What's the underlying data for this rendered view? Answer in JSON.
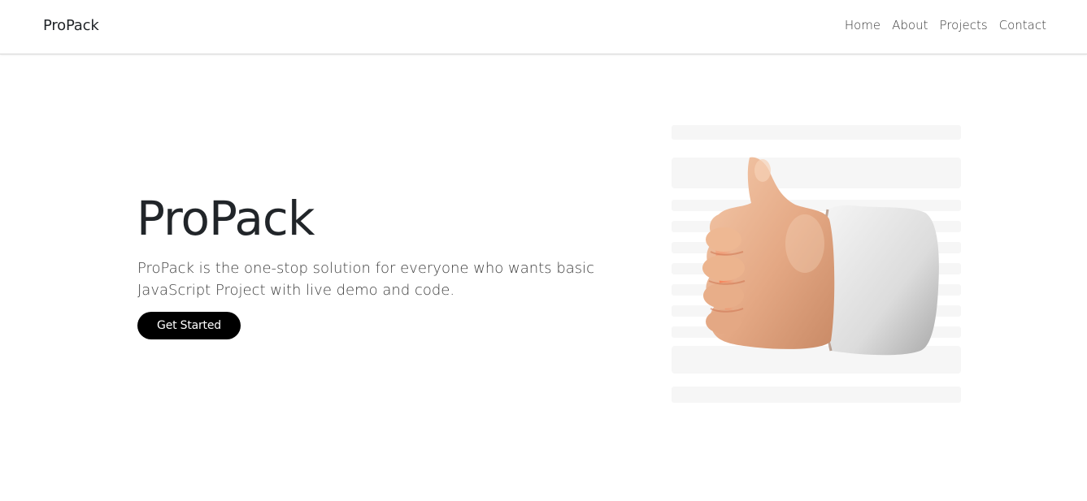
{
  "navbar": {
    "brand": "ProPack",
    "links": [
      "Home",
      "About",
      "Projects",
      "Contact"
    ]
  },
  "hero": {
    "title": "ProPack",
    "description": "ProPack is the one-stop solution for everyone who wants basic JavaScript Project with live demo and code.",
    "cta_label": "Get Started"
  },
  "illustration": {
    "icon": "thumbs-up-icon"
  },
  "colors": {
    "background": "#ffffff",
    "text": "#212529",
    "button_bg": "#000000",
    "button_text": "#ffffff"
  }
}
